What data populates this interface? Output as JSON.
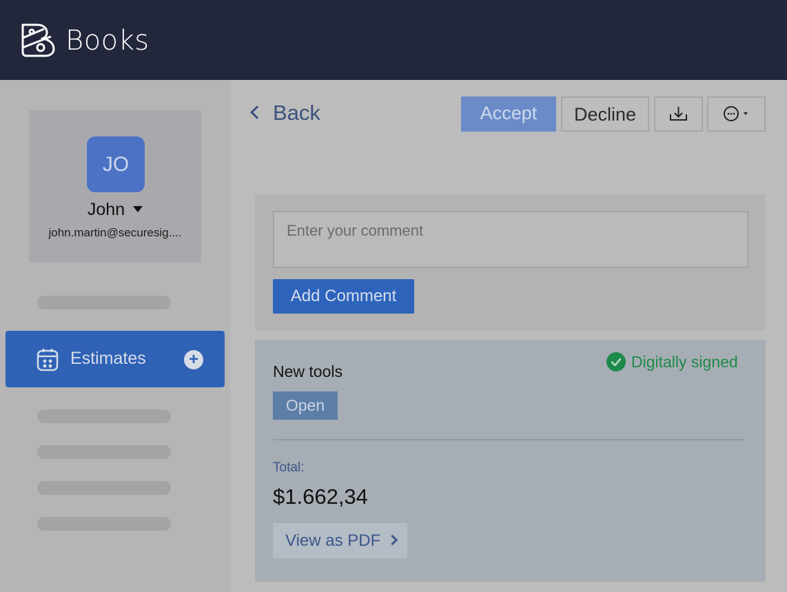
{
  "header": {
    "logo_icon": "books-logo-icon",
    "app_name": "Books"
  },
  "profile": {
    "initials": "JO",
    "name": "John",
    "email": "john.martin@securesig...."
  },
  "nav": {
    "active_item": {
      "label": "Estimates",
      "icon": "calendar-icon",
      "add_icon": "plus-icon"
    }
  },
  "toolbar": {
    "back_label": "Back",
    "accept_label": "Accept",
    "decline_label": "Decline",
    "download_icon": "download-icon",
    "more_icon": "more-options-icon"
  },
  "comment": {
    "placeholder": "Enter your comment",
    "value": "",
    "submit_label": "Add Comment"
  },
  "estimate": {
    "title": "New tools",
    "signed_label": "Digitally signed",
    "status": "Open",
    "total_label": "Total:",
    "total_value": "$1.662,34",
    "view_pdf_label": "View as PDF"
  },
  "colors": {
    "topbar": "#23273b",
    "accent_blue": "#2e64bb",
    "signed_green": "#1d8a4a"
  }
}
